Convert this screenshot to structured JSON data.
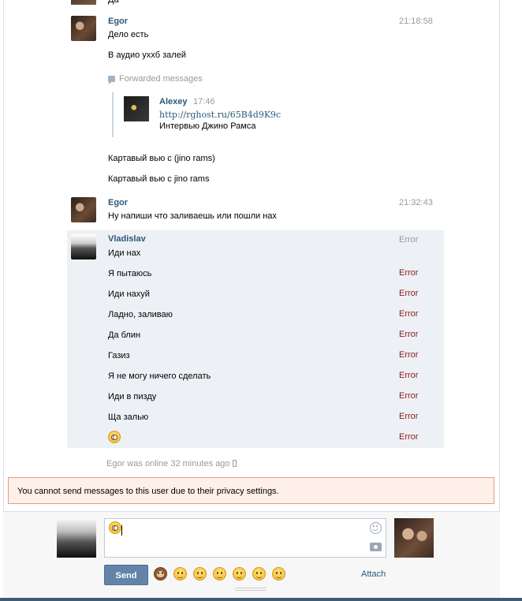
{
  "top_fragment": "Да",
  "messages": {
    "egor1": {
      "author": "Egor",
      "time": "21:18:58",
      "lines": [
        "Дело есть",
        "В аудио ухxб залей"
      ],
      "forwarded_label": "Forwarded messages",
      "forwarded": {
        "author": "Alexey",
        "time": "17:46",
        "link": "http://rghost.ru/65B4d9K9c",
        "text": "Интервью Джино Рамса"
      },
      "after_lines": [
        "Картавый вью с (jino rams)",
        "Картавый вью с jino rams"
      ]
    },
    "egor2": {
      "author": "Egor",
      "time": "21:32:43",
      "text": "Ну напиши что заливаешь или пошли нах"
    },
    "vladislav": {
      "author": "Vladislav",
      "status_first": "Error",
      "lines": [
        {
          "text": "Иди нах",
          "status": "Error"
        },
        {
          "text": "Я пытаюсь",
          "status": "Error"
        },
        {
          "text": "Иди нахуй",
          "status": "Error"
        },
        {
          "text": "Ладно, заливаю",
          "status": "Error"
        },
        {
          "text": "Да блин",
          "status": "Error"
        },
        {
          "text": "Газиз",
          "status": "Error"
        },
        {
          "text": "Я не могу ничего сделать",
          "status": "Error"
        },
        {
          "text": "Иди в пизду",
          "status": "Error"
        },
        {
          "text": "Ща залью",
          "status": "Error"
        },
        {
          "text": "",
          "status": "Error"
        }
      ]
    }
  },
  "online_status": "Egor was online 32 minutes ago",
  "privacy_notice": "You cannot send messages to this user due to their privacy settings.",
  "composer": {
    "send_label": "Send",
    "attach_label": "Attach",
    "emoji_palette": [
      "see-no-evil-monkey",
      "flushed-face",
      "sweat-smile",
      "relieved-face",
      "grimacing-face",
      "winking-tongue-face",
      "blush-face"
    ]
  },
  "colors": {
    "link": "#2b587a",
    "error": "#8c1b1b",
    "highlight_bg": "#edf1f5",
    "notice_bg": "#ffefe9",
    "notice_border": "#e89b88",
    "send_button": "#6383a8"
  }
}
